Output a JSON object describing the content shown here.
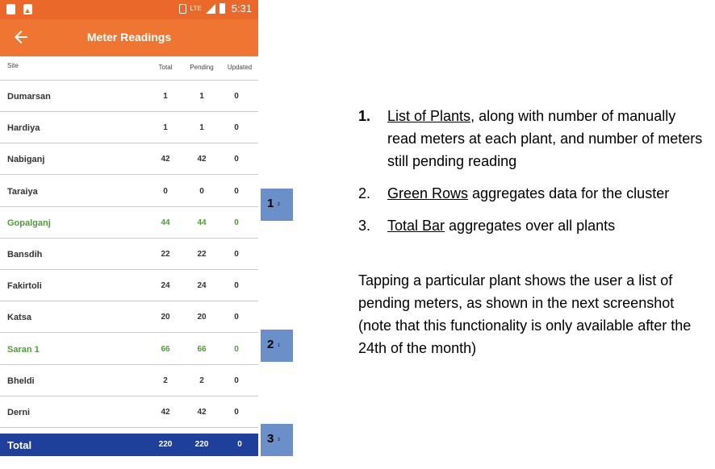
{
  "status_bar": {
    "time": "5:31",
    "network": "LTE"
  },
  "app_bar": {
    "title": "Meter Readings"
  },
  "table": {
    "headers": {
      "site": "Site",
      "total": "Total",
      "pending": "Pending",
      "updated": "Updated"
    },
    "rows": [
      {
        "site": "Dumarsan",
        "total": "1",
        "pending": "1",
        "updated": "0",
        "highlight": false
      },
      {
        "site": "Hardiya",
        "total": "1",
        "pending": "1",
        "updated": "0",
        "highlight": false
      },
      {
        "site": "Nabiganj",
        "total": "42",
        "pending": "42",
        "updated": "0",
        "highlight": false
      },
      {
        "site": "Taraiya",
        "total": "0",
        "pending": "0",
        "updated": "0",
        "highlight": false
      },
      {
        "site": "Gopalganj",
        "total": "44",
        "pending": "44",
        "updated": "0",
        "highlight": true
      },
      {
        "site": "Bansdih",
        "total": "22",
        "pending": "22",
        "updated": "0",
        "highlight": false
      },
      {
        "site": "Fakirtoli",
        "total": "24",
        "pending": "24",
        "updated": "0",
        "highlight": false
      },
      {
        "site": "Katsa",
        "total": "20",
        "pending": "20",
        "updated": "0",
        "highlight": false
      },
      {
        "site": "Saran 1",
        "total": "66",
        "pending": "66",
        "updated": "0",
        "highlight": true
      },
      {
        "site": "Bheldi",
        "total": "2",
        "pending": "2",
        "updated": "0",
        "highlight": false
      },
      {
        "site": "Derni",
        "total": "42",
        "pending": "42",
        "updated": "0",
        "highlight": false
      }
    ],
    "total": {
      "label": "Total",
      "total": "220",
      "pending": "220",
      "updated": "0"
    }
  },
  "callouts": [
    {
      "num": "1",
      "sub": "2"
    },
    {
      "num": "2",
      "sub": "1"
    },
    {
      "num": "3",
      "sub": "3"
    }
  ],
  "notes": {
    "items": [
      {
        "num": "1.",
        "link": "List of Plants",
        "rest": ", along with number of manually read meters at each plant, and number of meters still pending reading"
      },
      {
        "num": "2.",
        "link": "Green Rows",
        "rest": " aggregates data for the cluster"
      },
      {
        "num": "3.",
        "link": "Total Bar",
        "rest": " aggregates over all plants"
      }
    ],
    "paragraph": "Tapping a particular plant shows the user a list of pending meters, as shown in the next screenshot (note that this functionality is only available after the 24th of the month)"
  },
  "colors": {
    "app_bar": "#ee7632",
    "status_bar": "#e9682a",
    "green_row": "#4f9a3b",
    "total_bar": "#1e3f9a",
    "callout": "#6b8fc9"
  },
  "icons": [
    "back-arrow-icon",
    "battery-icon",
    "signal-icon",
    "vibrate-icon",
    "notification-icon",
    "image-icon"
  ]
}
